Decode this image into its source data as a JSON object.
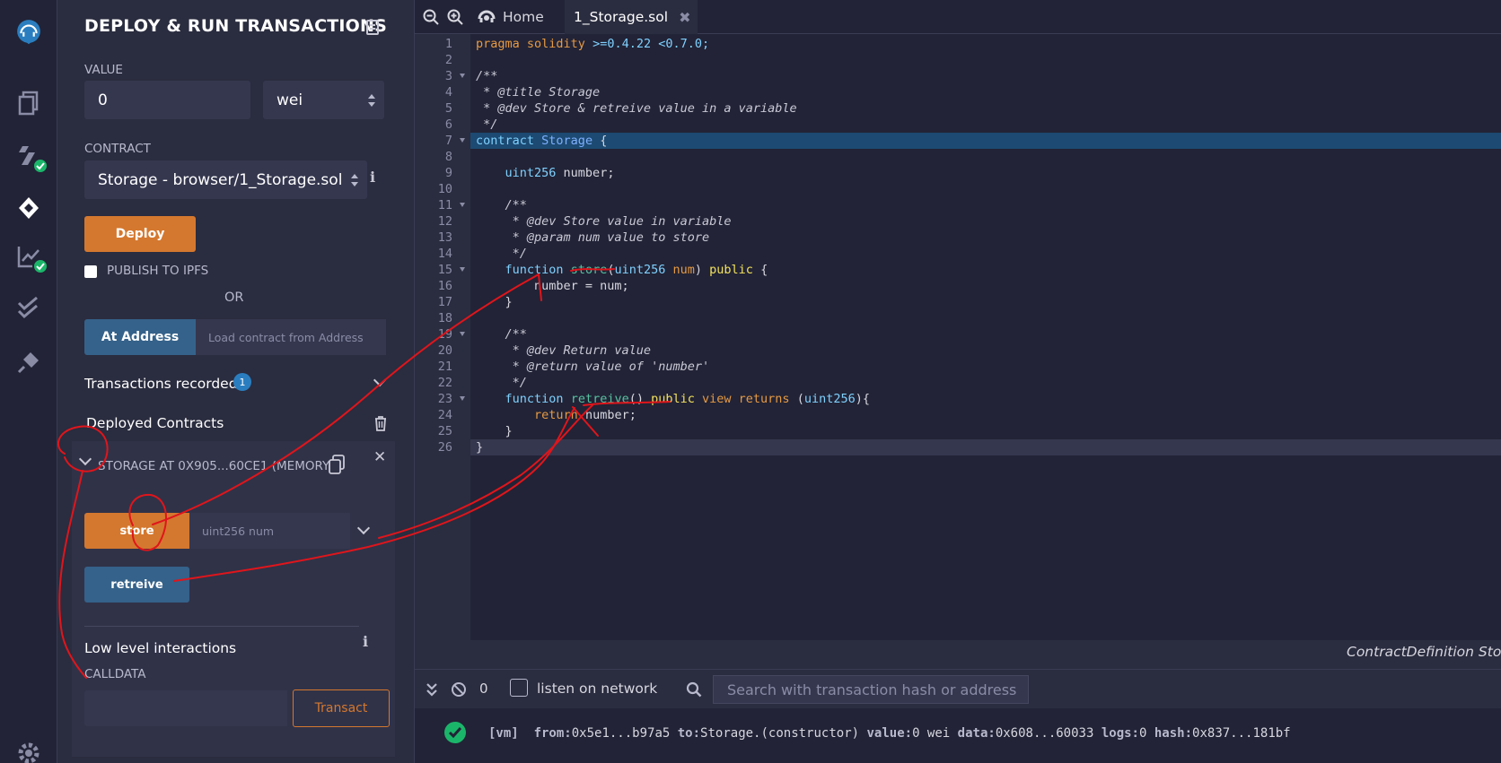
{
  "panel": {
    "title": "DEPLOY & RUN TRANSACTIONS",
    "value_label": "VALUE",
    "value": "0",
    "unit": "wei",
    "contract_label": "CONTRACT",
    "contract_selected": "Storage - browser/1_Storage.sol",
    "deploy_label": "Deploy",
    "publish_label": "PUBLISH TO IPFS",
    "or_label": "OR",
    "at_address_label": "At Address",
    "at_address_placeholder": "Load contract from Address",
    "transactions_recorded": "Transactions recorded",
    "transactions_count": "1",
    "deployed_contracts": "Deployed Contracts",
    "instance_label": "STORAGE AT 0X905...60CE1 (MEMORY)",
    "store_label": "store",
    "store_placeholder": "uint256 num",
    "retreive_label": "retreive",
    "low_level": "Low level interactions",
    "calldata_label": "CALLDATA",
    "transact_label": "Transact"
  },
  "tabs": [
    {
      "label": "Home"
    },
    {
      "label": "1_Storage.sol"
    }
  ],
  "editor": {
    "lines": [
      "1",
      "2",
      "3",
      "4",
      "5",
      "6",
      "7",
      "8",
      "9",
      "10",
      "11",
      "12",
      "13",
      "14",
      "15",
      "16",
      "17",
      "18",
      "19",
      "20",
      "21",
      "22",
      "23",
      "24",
      "25",
      "26"
    ],
    "status_right": "ContractDefinition Stor"
  },
  "terminal": {
    "count": "0",
    "listen_label": "listen on network",
    "search_placeholder": "Search with transaction hash or address",
    "log": {
      "tag": "[vm]",
      "from_k": "from:",
      "from_v": "0x5e1...b97a5",
      "to_k": "to:",
      "to_v": "Storage.(constructor)",
      "value_k": "value:",
      "value_v": "0 wei",
      "data_k": "data:",
      "data_v": "0x608...60033",
      "logs_k": "logs:",
      "logs_v": "0",
      "hash_k": "hash:",
      "hash_v": "0x837...181bf"
    }
  },
  "colors": {
    "accent_orange": "#d4782f",
    "accent_blue": "#35628a",
    "success_green": "#1bb56a",
    "annotation_red": "#e0151b"
  }
}
